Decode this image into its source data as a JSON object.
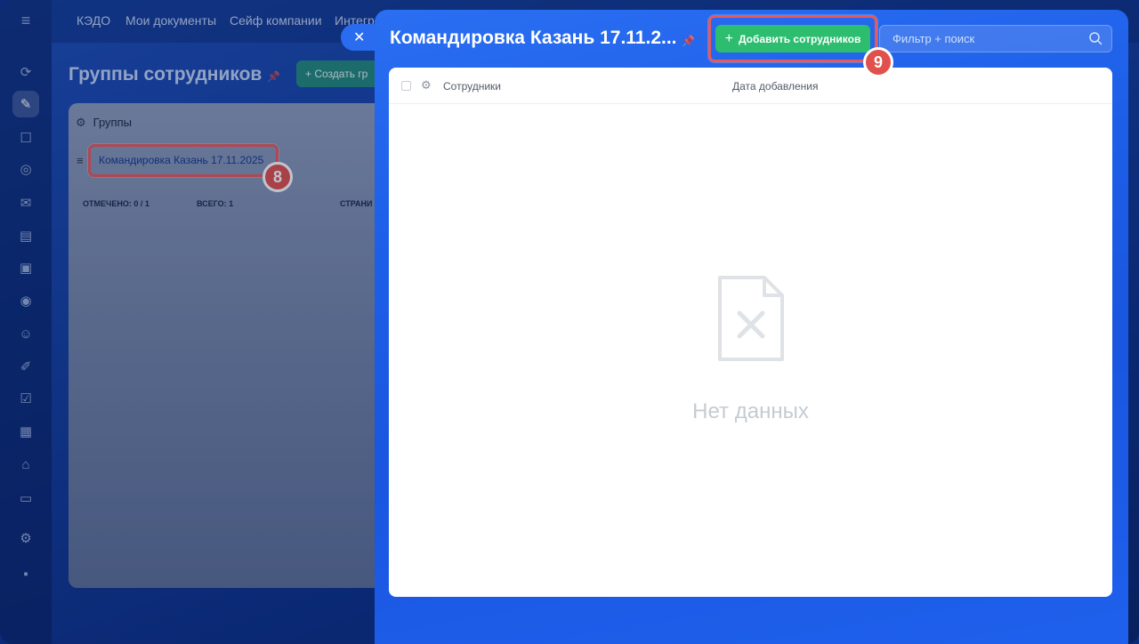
{
  "background": {
    "top_nav": [
      "КЭДО",
      "Мои документы",
      "Сейф компании",
      "Интегр"
    ],
    "page_title": "Группы сотрудников",
    "create_button": "Создать гр",
    "groups_header": "Группы",
    "group_row": "Командировка Казань 17.11.2025",
    "footer": {
      "marked_label": "ОТМЕЧЕНО:",
      "marked_value": "0 / 1",
      "total_label": "ВСЕГО:",
      "total_value": "1",
      "pages_label": "СТРАНИ"
    }
  },
  "slider": {
    "title": "Командировка Казань 17.11.2...",
    "add_button": "Добавить сотрудников",
    "search_placeholder": "Фильтр + поиск",
    "columns": [
      "Сотрудники",
      "Дата добавления"
    ],
    "empty_text": "Нет данных"
  },
  "annotations": {
    "badge_8": "8",
    "badge_9": "9"
  },
  "colors": {
    "accent_green": "#2dbd6f",
    "slider_blue": "#1d5fe8",
    "highlight_red": "#e85a5a"
  }
}
